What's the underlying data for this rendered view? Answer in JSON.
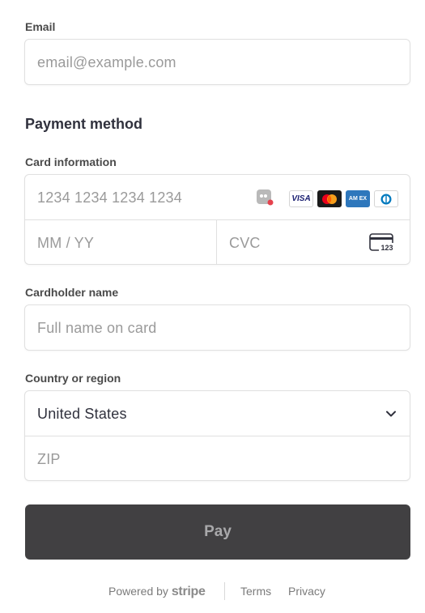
{
  "email": {
    "label": "Email",
    "placeholder": "email@example.com"
  },
  "payment": {
    "heading": "Payment method",
    "card_label": "Card information",
    "card_number_placeholder": "1234 1234 1234 1234",
    "expiry_placeholder": "MM / YY",
    "cvc_placeholder": "CVC",
    "cvc_icon_text": "123",
    "brands": [
      "link-icon",
      "visa-icon",
      "mastercard-icon",
      "amex-icon",
      "diners-icon"
    ],
    "visa_text": "VISA",
    "amex_text": "AM EX"
  },
  "cardholder": {
    "label": "Cardholder name",
    "placeholder": "Full name on card"
  },
  "country": {
    "label": "Country or region",
    "selected": "United States",
    "zip_placeholder": "ZIP"
  },
  "pay_button": "Pay",
  "footer": {
    "powered_by": "Powered by",
    "brand": "stripe",
    "terms": "Terms",
    "privacy": "Privacy"
  },
  "colors": {
    "pay_button_bg": "#414042",
    "border": "#e0e0e0",
    "placeholder": "#9a9a9a"
  }
}
